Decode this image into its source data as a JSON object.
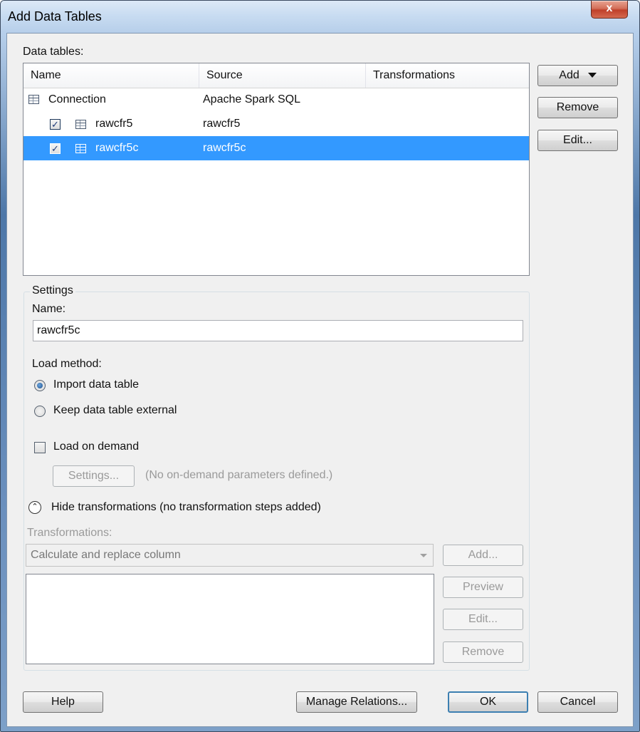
{
  "window": {
    "title": "Add Data Tables",
    "close_glyph": "x"
  },
  "data_tables": {
    "label": "Data tables:",
    "columns": [
      "Name",
      "Source",
      "Transformations"
    ],
    "rows": [
      {
        "name": "Connection",
        "source": "Apache Spark SQL",
        "transformations": ""
      },
      {
        "name": "rawcfr5",
        "source": "rawcfr5",
        "transformations": "",
        "checked": true
      },
      {
        "name": "rawcfr5c",
        "source": "rawcfr5c",
        "transformations": "",
        "checked": true,
        "selected": true
      }
    ]
  },
  "side_buttons": {
    "add": "Add",
    "remove": "Remove",
    "edit": "Edit..."
  },
  "settings": {
    "legend": "Settings",
    "name_label": "Name:",
    "name_value": "rawcfr5c",
    "load_method_label": "Load method:",
    "load_options": [
      "Import data table",
      "Keep data table external"
    ],
    "selected_load_option": "Import data table",
    "load_on_demand_label": "Load on demand",
    "load_on_demand_checked": false,
    "settings_button": "Settings...",
    "on_demand_note": "(No on-demand parameters defined.)",
    "hide_transformations": "Hide transformations (no transformation steps added)",
    "transformations_label": "Transformations:",
    "transformation_type": "Calculate and replace column",
    "transformation_buttons": {
      "add": "Add...",
      "preview": "Preview",
      "edit": "Edit...",
      "remove": "Remove"
    }
  },
  "footer": {
    "help": "Help",
    "manage_relations": "Manage Relations...",
    "ok": "OK",
    "cancel": "Cancel"
  },
  "check_glyph": "✓",
  "colors": {
    "selection": "#3399ff",
    "titlebar": "#c7dbf1",
    "close_button": "#c0402a",
    "dialog_background": "#f0f0f0"
  }
}
